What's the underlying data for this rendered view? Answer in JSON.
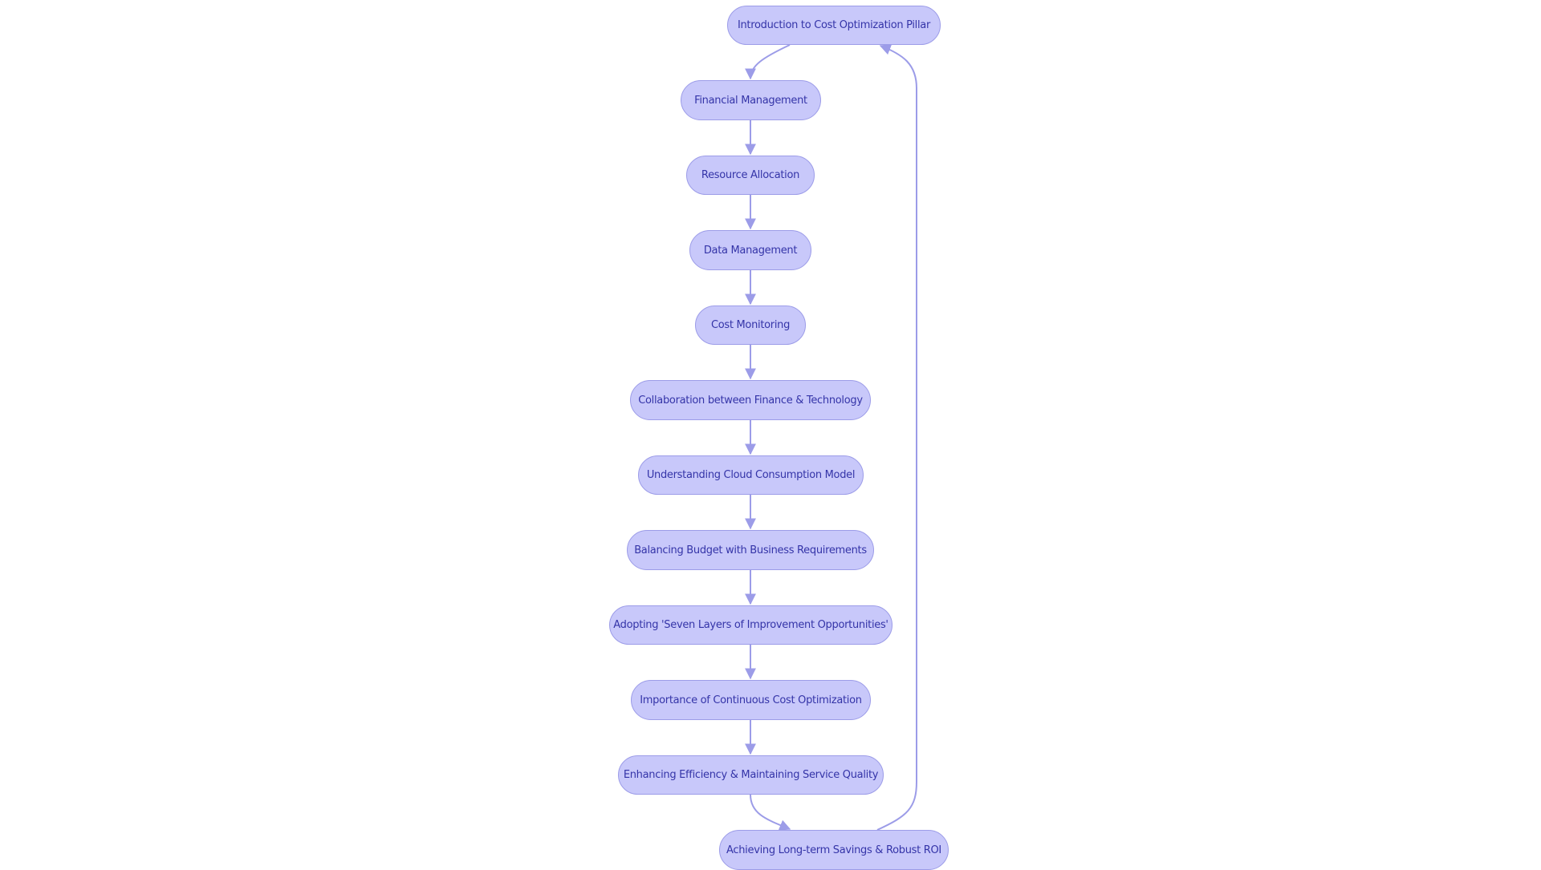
{
  "diagram": {
    "type": "flowchart",
    "colors": {
      "node_fill": "#c8c8fa",
      "node_border": "#9c9ce8",
      "node_text": "#3434a8",
      "edge": "#9c9ce8"
    },
    "nodes": [
      {
        "id": "intro",
        "label": "Introduction to Cost Optimization Pillar"
      },
      {
        "id": "financial",
        "label": "Financial Management"
      },
      {
        "id": "resource",
        "label": "Resource Allocation"
      },
      {
        "id": "data",
        "label": "Data Management"
      },
      {
        "id": "monitoring",
        "label": "Cost Monitoring"
      },
      {
        "id": "collab",
        "label": "Collaboration between Finance & Technology"
      },
      {
        "id": "consumption",
        "label": "Understanding Cloud Consumption Model"
      },
      {
        "id": "budget",
        "label": "Balancing Budget with Business Requirements"
      },
      {
        "id": "sevenlayers",
        "label": "Adopting 'Seven Layers of Improvement Opportunities'"
      },
      {
        "id": "continuous",
        "label": "Importance of Continuous Cost Optimization"
      },
      {
        "id": "efficiency",
        "label": "Enhancing Efficiency & Maintaining Service Quality"
      },
      {
        "id": "savings",
        "label": "Achieving Long-term Savings & Robust ROI"
      }
    ],
    "edges": [
      {
        "from": "intro",
        "to": "financial"
      },
      {
        "from": "financial",
        "to": "resource"
      },
      {
        "from": "resource",
        "to": "data"
      },
      {
        "from": "data",
        "to": "monitoring"
      },
      {
        "from": "monitoring",
        "to": "collab"
      },
      {
        "from": "collab",
        "to": "consumption"
      },
      {
        "from": "consumption",
        "to": "budget"
      },
      {
        "from": "budget",
        "to": "sevenlayers"
      },
      {
        "from": "sevenlayers",
        "to": "continuous"
      },
      {
        "from": "continuous",
        "to": "efficiency"
      },
      {
        "from": "efficiency",
        "to": "savings"
      },
      {
        "from": "savings",
        "to": "intro"
      }
    ]
  }
}
